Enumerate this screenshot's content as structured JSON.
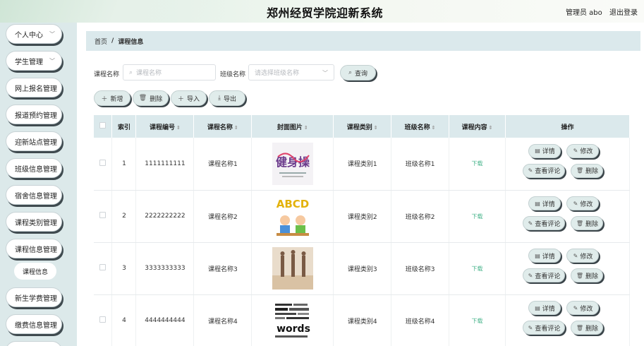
{
  "header": {
    "title": "郑州经贸学院迎新系统",
    "user": "管理员 abo",
    "logout": "退出登录"
  },
  "sidebar": {
    "items": [
      {
        "label": "个人中心",
        "chevron": true
      },
      {
        "label": "学生管理",
        "chevron": true
      },
      {
        "label": "网上报名管理"
      },
      {
        "label": "报道预约管理"
      },
      {
        "label": "迎新站点管理"
      },
      {
        "label": "班级信息管理"
      },
      {
        "label": "宿舍信息管理"
      },
      {
        "label": "课程类别管理"
      },
      {
        "label": "课程信息管理"
      },
      {
        "label": "新生学费管理"
      },
      {
        "label": "缴费信息管理"
      }
    ],
    "submenu": {
      "label": "课程信息"
    }
  },
  "breadcrumb": {
    "home": "首页",
    "separator": "/",
    "current": "课程信息"
  },
  "filters": {
    "course_name_label": "课程名称",
    "course_name_placeholder": "课程名称",
    "class_name_label": "班级名称",
    "class_name_placeholder": "请选择班级名称",
    "search_label": "查询"
  },
  "actions": {
    "add": "新增",
    "delete": "删除",
    "import": "导入",
    "export": "导出"
  },
  "table": {
    "headers": {
      "index": "索引",
      "code": "课程编号",
      "name": "课程名称",
      "cover": "封面图片",
      "category": "课程类别",
      "class": "班级名称",
      "content": "课程内容",
      "ops": "操作"
    },
    "rows": [
      {
        "index": "1",
        "code": "1111111111",
        "name": "课程名称1",
        "category": "课程类别1",
        "class": "班级名称1",
        "content": "下载",
        "cover_text": "健身操"
      },
      {
        "index": "2",
        "code": "2222222222",
        "name": "课程名称2",
        "category": "课程类别2",
        "class": "班级名称2",
        "content": "下载",
        "cover_text": "ABCD"
      },
      {
        "index": "3",
        "code": "3333333333",
        "name": "课程名称3",
        "category": "课程类别3",
        "class": "班级名称3",
        "content": "下载",
        "cover_text": ""
      },
      {
        "index": "4",
        "code": "4444444444",
        "name": "课程名称4",
        "category": "课程类别4",
        "class": "班级名称4",
        "content": "下载",
        "cover_text": "words"
      }
    ],
    "row_ops": {
      "detail": "详情",
      "edit": "修改",
      "comments": "查看评论",
      "delete": "删除"
    }
  }
}
